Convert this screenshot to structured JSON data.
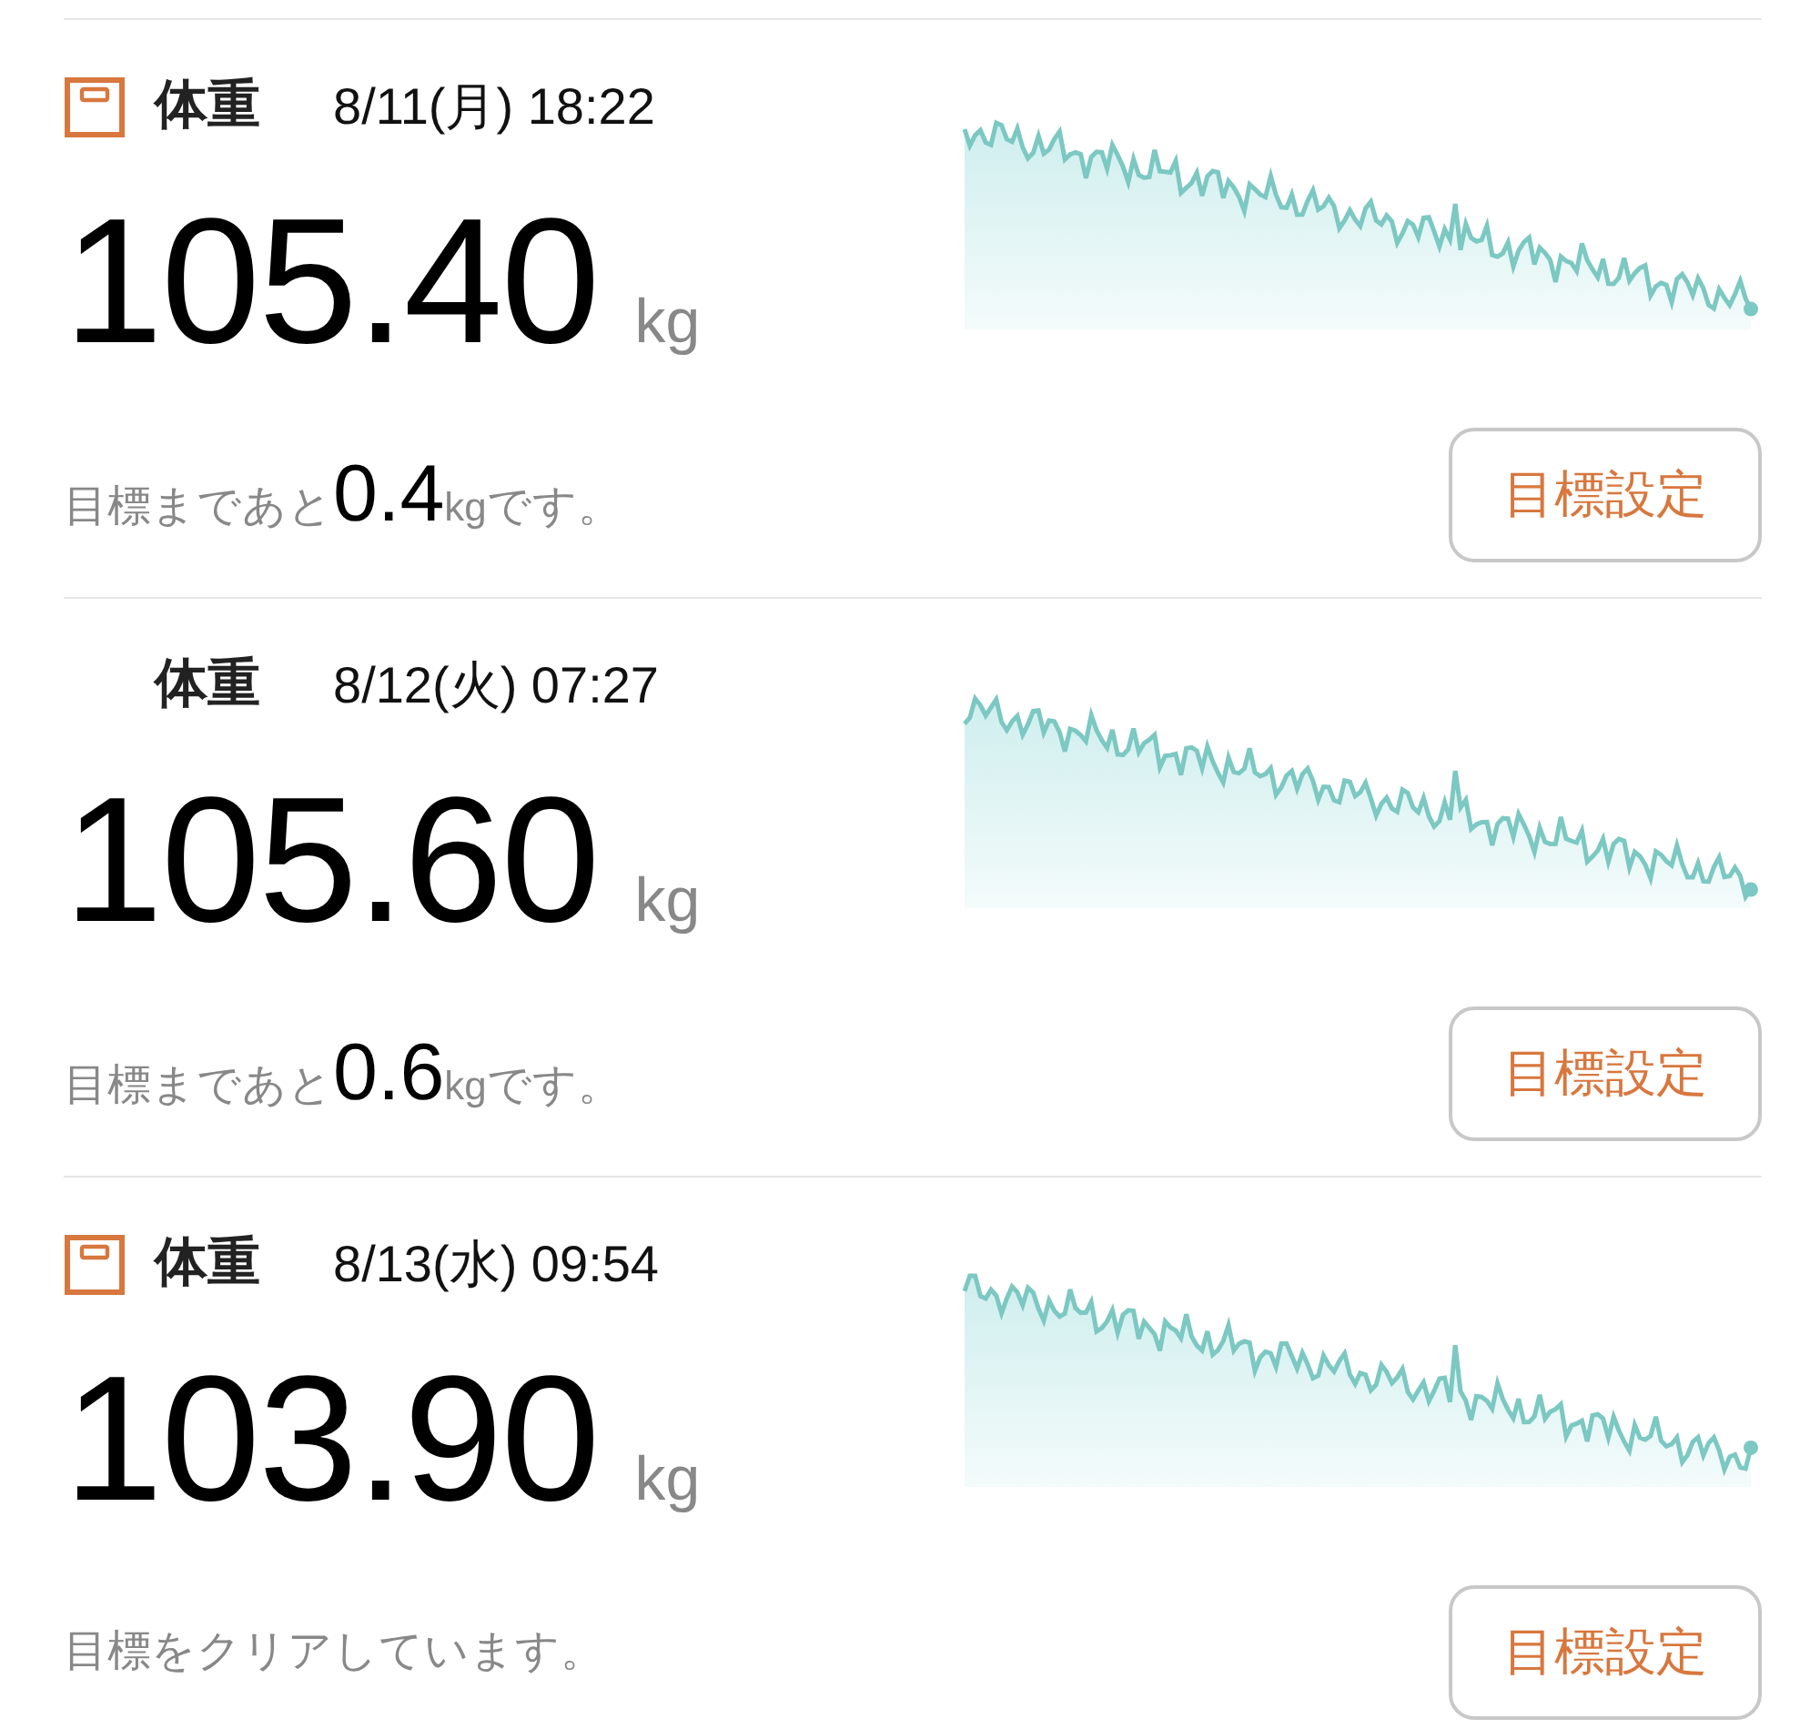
{
  "entries": [
    {
      "show_icon": true,
      "title": "体重",
      "datetime": "8/11(月) 18:22",
      "value": "105.40",
      "unit": "kg",
      "goal": {
        "kind": "remaining",
        "prefix": "目標まであと",
        "amount": "0.4",
        "unit": "kg",
        "suffix": "です。"
      },
      "button": "目標設定"
    },
    {
      "show_icon": false,
      "title": "体重",
      "datetime": "8/12(火) 07:27",
      "value": "105.60",
      "unit": "kg",
      "goal": {
        "kind": "remaining",
        "prefix": "目標まであと",
        "amount": "0.6",
        "unit": "kg",
        "suffix": "です。"
      },
      "button": "目標設定"
    },
    {
      "show_icon": true,
      "title": "体重",
      "datetime": "8/13(水) 09:54",
      "value": "103.90",
      "unit": "kg",
      "goal": {
        "kind": "cleared",
        "text": "目標をクリアしています。"
      },
      "button": "目標設定"
    }
  ]
}
